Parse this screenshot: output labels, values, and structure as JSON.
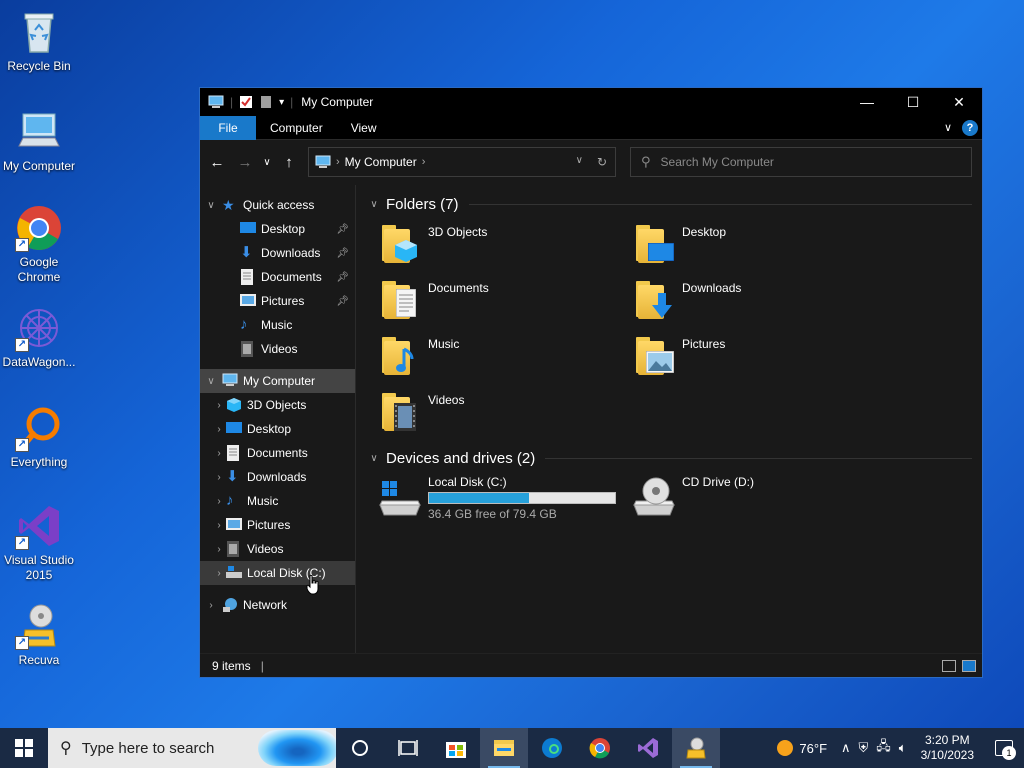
{
  "desktop": {
    "icons": [
      {
        "label": "Recycle Bin"
      },
      {
        "label": "My Computer"
      },
      {
        "label": "Google Chrome"
      },
      {
        "label": "DataWagon..."
      },
      {
        "label": "Everything"
      },
      {
        "label": "Visual Studio 2015"
      },
      {
        "label": "Recuva"
      }
    ]
  },
  "window": {
    "title": "My Computer",
    "ribbon": {
      "file": "File",
      "computer": "Computer",
      "view": "View",
      "help": "?"
    },
    "address": {
      "path": "My Computer"
    },
    "search": {
      "placeholder": "Search My Computer"
    },
    "nav": {
      "quick_access": "Quick access",
      "quick_items": [
        "Desktop",
        "Downloads",
        "Documents",
        "Pictures",
        "Music",
        "Videos"
      ],
      "my_computer": "My Computer",
      "pc_items": [
        "3D Objects",
        "Desktop",
        "Documents",
        "Downloads",
        "Music",
        "Pictures",
        "Videos",
        "Local Disk (C:)"
      ],
      "network": "Network"
    },
    "folders_header": "Folders (7)",
    "folders": [
      "3D Objects",
      "Desktop",
      "Documents",
      "Downloads",
      "Music",
      "Pictures",
      "Videos"
    ],
    "devices_header": "Devices and drives (2)",
    "drives": [
      {
        "name": "Local Disk (C:)",
        "free": "36.4 GB free of 79.4 GB",
        "used_fraction": 0.54
      },
      {
        "name": "CD Drive (D:)"
      }
    ],
    "status": {
      "items": "9 items"
    }
  },
  "taskbar": {
    "search_placeholder": "Type here to search",
    "weather": "76°F",
    "time": "3:20 PM",
    "date": "3/10/2023",
    "notifications": "1"
  },
  "colors": {
    "accent": "#1979ca",
    "drive_bar": "#26a0da"
  }
}
